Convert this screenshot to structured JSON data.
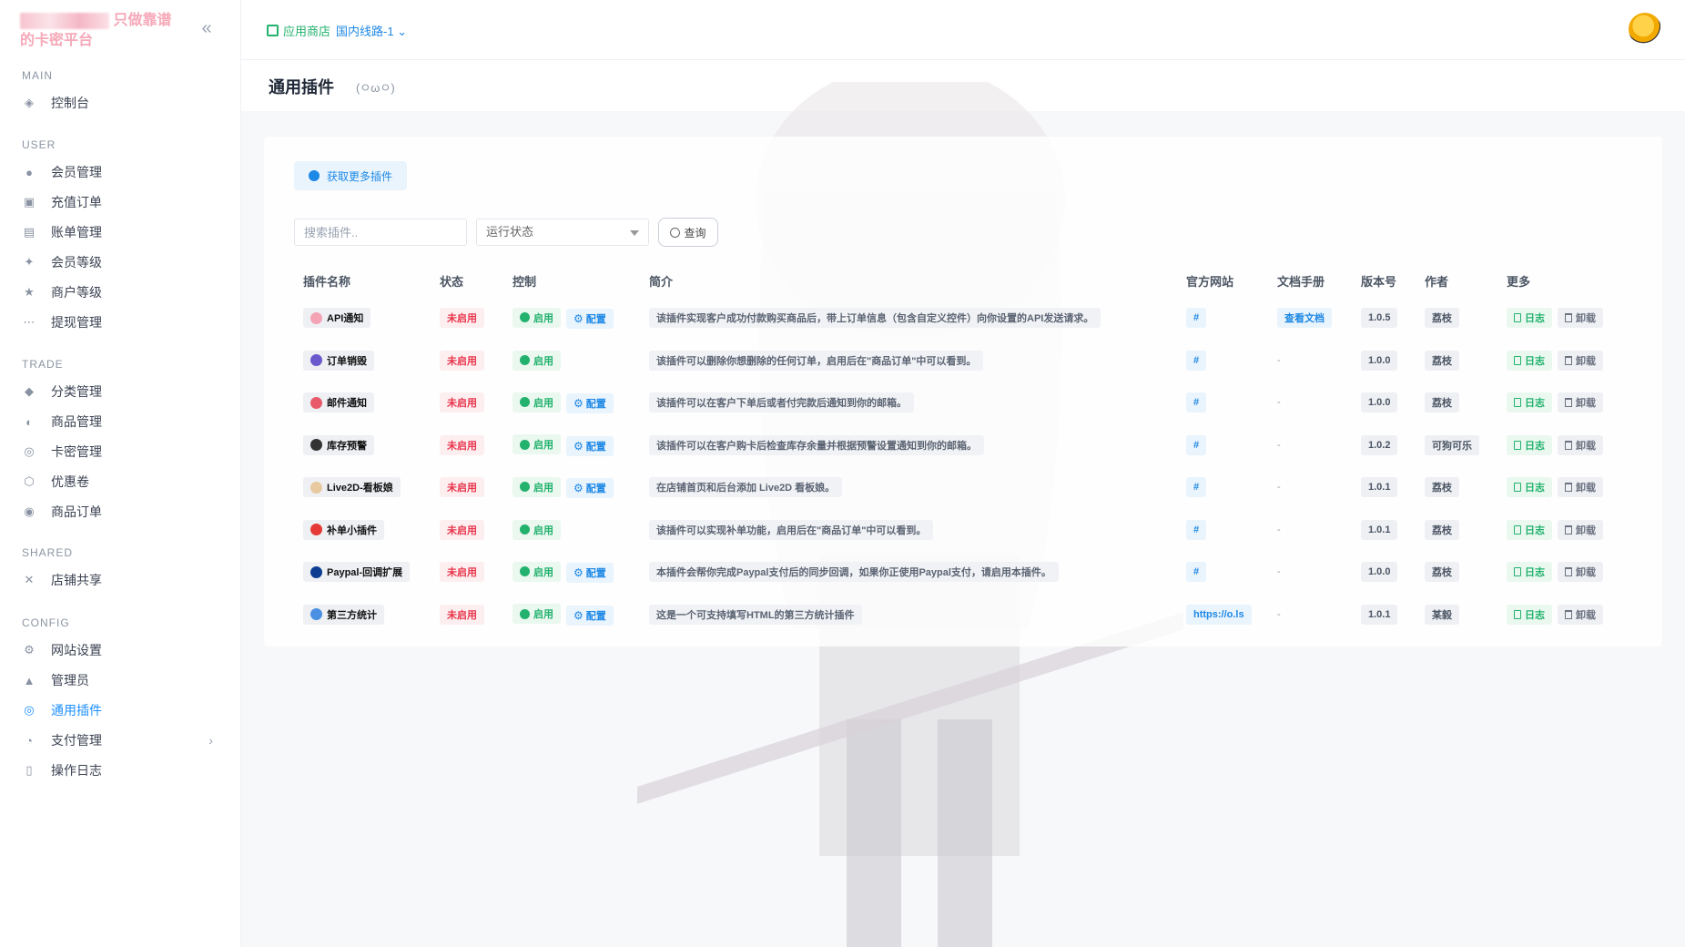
{
  "brand": {
    "slogan": "只做靠谱",
    "line2": "的卡密平台"
  },
  "sidebar": {
    "sections": [
      {
        "title": "MAIN",
        "items": [
          {
            "label": "控制台",
            "icon": "dashboard-icon"
          }
        ]
      },
      {
        "title": "USER",
        "items": [
          {
            "label": "会员管理",
            "icon": "user-icon"
          },
          {
            "label": "充值订单",
            "icon": "recharge-icon"
          },
          {
            "label": "账单管理",
            "icon": "bill-icon"
          },
          {
            "label": "会员等级",
            "icon": "level-icon"
          },
          {
            "label": "商户等级",
            "icon": "merchant-icon"
          },
          {
            "label": "提现管理",
            "icon": "withdraw-icon"
          }
        ]
      },
      {
        "title": "TRADE",
        "items": [
          {
            "label": "分类管理",
            "icon": "category-icon"
          },
          {
            "label": "商品管理",
            "icon": "product-icon"
          },
          {
            "label": "卡密管理",
            "icon": "card-icon"
          },
          {
            "label": "优惠卷",
            "icon": "coupon-icon"
          },
          {
            "label": "商品订单",
            "icon": "order-icon"
          }
        ]
      },
      {
        "title": "SHARED",
        "items": [
          {
            "label": "店铺共享",
            "icon": "share-icon"
          }
        ]
      },
      {
        "title": "CONFIG",
        "items": [
          {
            "label": "网站设置",
            "icon": "settings-icon"
          },
          {
            "label": "管理员",
            "icon": "admin-icon"
          },
          {
            "label": "通用插件",
            "icon": "plugin-icon",
            "active": true
          },
          {
            "label": "支付管理",
            "icon": "payment-icon",
            "has_submenu": true
          },
          {
            "label": "操作日志",
            "icon": "log-icon"
          }
        ]
      }
    ]
  },
  "topbar": {
    "store_label": "应用商店",
    "route_label": "国内线路-1"
  },
  "page": {
    "title": "通用插件",
    "subtitle": "(ㅇωㅇ)"
  },
  "toolbar": {
    "more_plugins_label": "获取更多插件",
    "search_placeholder": "搜索插件..",
    "status_select": "运行状态",
    "query_label": "查询"
  },
  "table": {
    "headers": [
      "插件名称",
      "状态",
      "控制",
      "简介",
      "官方网站",
      "文档手册",
      "版本号",
      "作者",
      "更多"
    ],
    "status_off": "未启用",
    "start_label": "启用",
    "config_label": "配置",
    "log_label": "日志",
    "uninstall_label": "卸载",
    "rows": [
      {
        "name": "API通知",
        "color": "#f4a3b5",
        "has_config": true,
        "desc": "该插件实现客户成功付款购买商品后，带上订单信息（包含自定义控件）向你设置的API发送请求。",
        "site": "#",
        "doc": "查看文档",
        "version": "1.0.5",
        "author": "荔枝"
      },
      {
        "name": "订单销毁",
        "color": "#6a5acd",
        "has_config": false,
        "desc": "该插件可以删除你想删除的任何订单，启用后在\"商品订单\"中可以看到。",
        "site": "#",
        "doc": "-",
        "version": "1.0.0",
        "author": "荔枝"
      },
      {
        "name": "邮件通知",
        "color": "#e85a6a",
        "has_config": true,
        "desc": "该插件可以在客户下单后或者付完款后通知到你的邮箱。",
        "site": "#",
        "doc": "-",
        "version": "1.0.0",
        "author": "荔枝"
      },
      {
        "name": "库存预警",
        "color": "#333333",
        "has_config": true,
        "desc": "该插件可以在客户购卡后检查库存余量并根据预警设置通知到你的邮箱。",
        "site": "#",
        "doc": "-",
        "version": "1.0.2",
        "author": "可狗可乐"
      },
      {
        "name": "Live2D-看板娘",
        "color": "#e8c9a0",
        "has_config": true,
        "desc": "在店铺首页和后台添加 Live2D 看板娘。",
        "site": "#",
        "doc": "-",
        "version": "1.0.1",
        "author": "荔枝"
      },
      {
        "name": "补单小插件",
        "color": "#e53935",
        "has_config": false,
        "desc": "该插件可以实现补单功能，启用后在\"商品订单\"中可以看到。",
        "site": "#",
        "doc": "-",
        "version": "1.0.1",
        "author": "荔枝"
      },
      {
        "name": "Paypal-回调扩展",
        "color": "#0a3d91",
        "has_config": true,
        "desc": "本插件会帮你完成Paypal支付后的同步回调，如果你正使用Paypal支付，请启用本插件。",
        "site": "#",
        "doc": "-",
        "version": "1.0.0",
        "author": "荔枝"
      },
      {
        "name": "第三方统计",
        "color": "#4a90e2",
        "has_config": true,
        "desc": "这是一个可支持填写HTML的第三方统计插件",
        "site": "https://o.ls",
        "doc": "-",
        "version": "1.0.1",
        "author": "某毅"
      }
    ]
  }
}
